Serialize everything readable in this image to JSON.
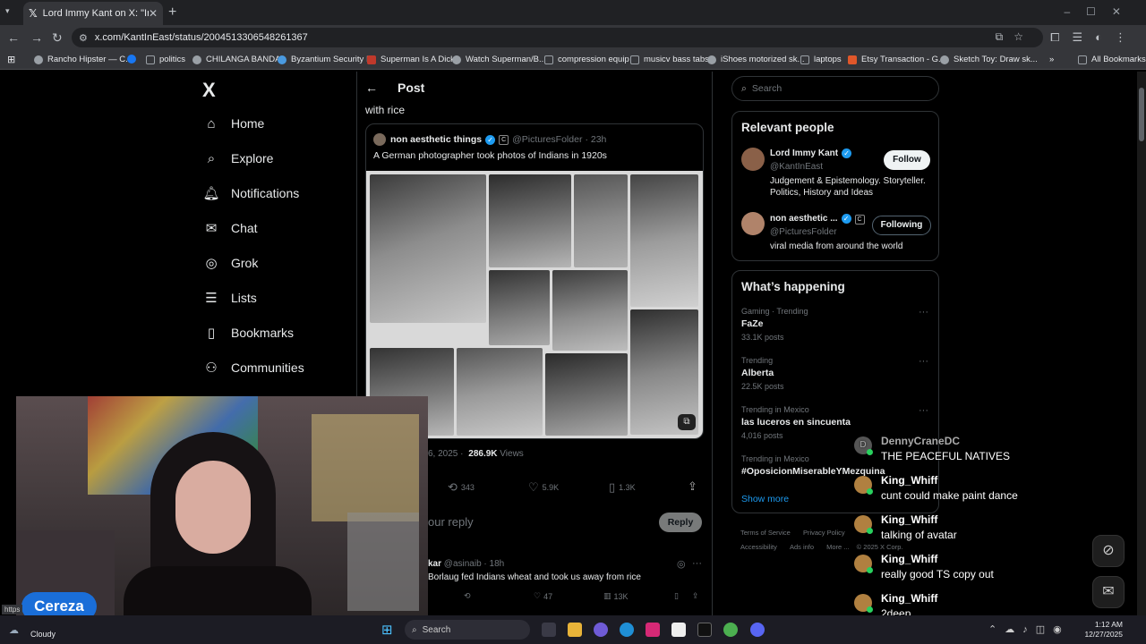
{
  "browser": {
    "tab_title": "Lord Immy Kant on X: \"Indians",
    "url": "x.com/KantInEast/status/2004513306548261367",
    "bookmarks": [
      {
        "label": "Rancho Hipster — C...",
        "color": "#9aa0a6"
      },
      {
        "label": "",
        "color": "#1877f2"
      },
      {
        "label": "politics",
        "color": "#9aa0a6"
      },
      {
        "label": "CHILANGA BANDA",
        "color": "#9aa0a6"
      },
      {
        "label": "Byzantium Security I...",
        "color": "#9aa0a6"
      },
      {
        "label": "Superman Is A Dick",
        "color": "#c0392b"
      },
      {
        "label": "Watch Superman/B...",
        "color": "#9aa0a6"
      },
      {
        "label": "compression equip",
        "color": "#9aa0a6"
      },
      {
        "label": "musicv bass tabs",
        "color": "#9aa0a6"
      },
      {
        "label": "iShoes motorized sk...",
        "color": "#9aa0a6"
      },
      {
        "label": "laptops",
        "color": "#9aa0a6"
      },
      {
        "label": "Etsy Transaction - G...",
        "color": "#e0572a"
      },
      {
        "label": "Sketch Toy: Draw sk...",
        "color": "#9aa0a6"
      }
    ],
    "more_bookmarks": "»",
    "all_bookmarks": "All Bookmarks",
    "status_url": "https"
  },
  "nav": {
    "logo": "X",
    "items": [
      {
        "label": "Home",
        "icon": "home-icon",
        "glyph": "⌂"
      },
      {
        "label": "Explore",
        "icon": "search-icon",
        "glyph": "⌕"
      },
      {
        "label": "Notifications",
        "icon": "bell-icon",
        "glyph": "♫"
      },
      {
        "label": "Chat",
        "icon": "mail-icon",
        "glyph": "✉"
      },
      {
        "label": "Grok",
        "icon": "grok-icon",
        "glyph": "◎"
      },
      {
        "label": "Lists",
        "icon": "list-icon",
        "glyph": "☰"
      },
      {
        "label": "Bookmarks",
        "icon": "bookmark-icon",
        "glyph": "⚑"
      },
      {
        "label": "Communities",
        "icon": "people-icon",
        "glyph": "⚇"
      }
    ]
  },
  "post": {
    "header": "Post",
    "text_tail": "with rice",
    "quote": {
      "author": "non aesthetic things",
      "handle": "@PicturesFolder",
      "time": "· 23h",
      "text": "A German photographer took photos of Indians in 1920s"
    },
    "meta_date": "6, 2025 ·",
    "views_count": "286.9K",
    "views_label": "Views",
    "retweets": "343",
    "likes": "5.9K",
    "bookmarks": "1.3K",
    "reply_placeholder": "our reply",
    "reply_button": "Reply",
    "reply2_author": "kar",
    "reply2_handle": "@asinaib · 18h",
    "reply2_text": "Borlaug fed Indians wheat and took us away from rice",
    "reply2_likes": "47",
    "reply2_views": "13K"
  },
  "sidebar": {
    "search_placeholder": "Search",
    "relevant_title": "Relevant people",
    "people": [
      {
        "name": "Lord Immy Kant",
        "handle": "@KantInEast",
        "bio": "Judgement & Epistemology. Storyteller. Politics, History and Ideas",
        "button": "Follow"
      },
      {
        "name": "non aesthetic ...",
        "handle": "@PicturesFolder",
        "bio": "viral media from around the world",
        "button": "Following"
      }
    ],
    "happening_title": "What’s happening",
    "trends": [
      {
        "context": "Gaming · Trending",
        "name": "FaZe",
        "posts": "33.1K posts"
      },
      {
        "context": "Trending",
        "name": "Alberta",
        "posts": "22.5K posts"
      },
      {
        "context": "Trending in Mexico",
        "name": "las luceros en sincuenta",
        "posts": "4,016 posts"
      },
      {
        "context": "Trending in Mexico",
        "name": "#OposicionMiserableYMezquina",
        "posts": ""
      }
    ],
    "show_more": "Show more",
    "footer": [
      "Terms of Service",
      "Privacy Policy",
      "Accessibility",
      "Ads info",
      "More ...",
      "© 2025 X Corp."
    ]
  },
  "chat": [
    {
      "user": "DennyCraneDC",
      "message": "THE PEACEFUL NATIVES"
    },
    {
      "user": "King_Whiff",
      "message": "cunt could make paint dance"
    },
    {
      "user": "King_Whiff",
      "message": "talking of avatar"
    },
    {
      "user": "King_Whiff",
      "message": "really good TS copy out"
    },
    {
      "user": "King_Whiff",
      "message": "2deep"
    }
  ],
  "streamer": {
    "name": "Cereza"
  },
  "taskbar": {
    "weather": "Cloudy",
    "search": "Search",
    "time": "1:12 AM",
    "date": "12/27/2025"
  }
}
